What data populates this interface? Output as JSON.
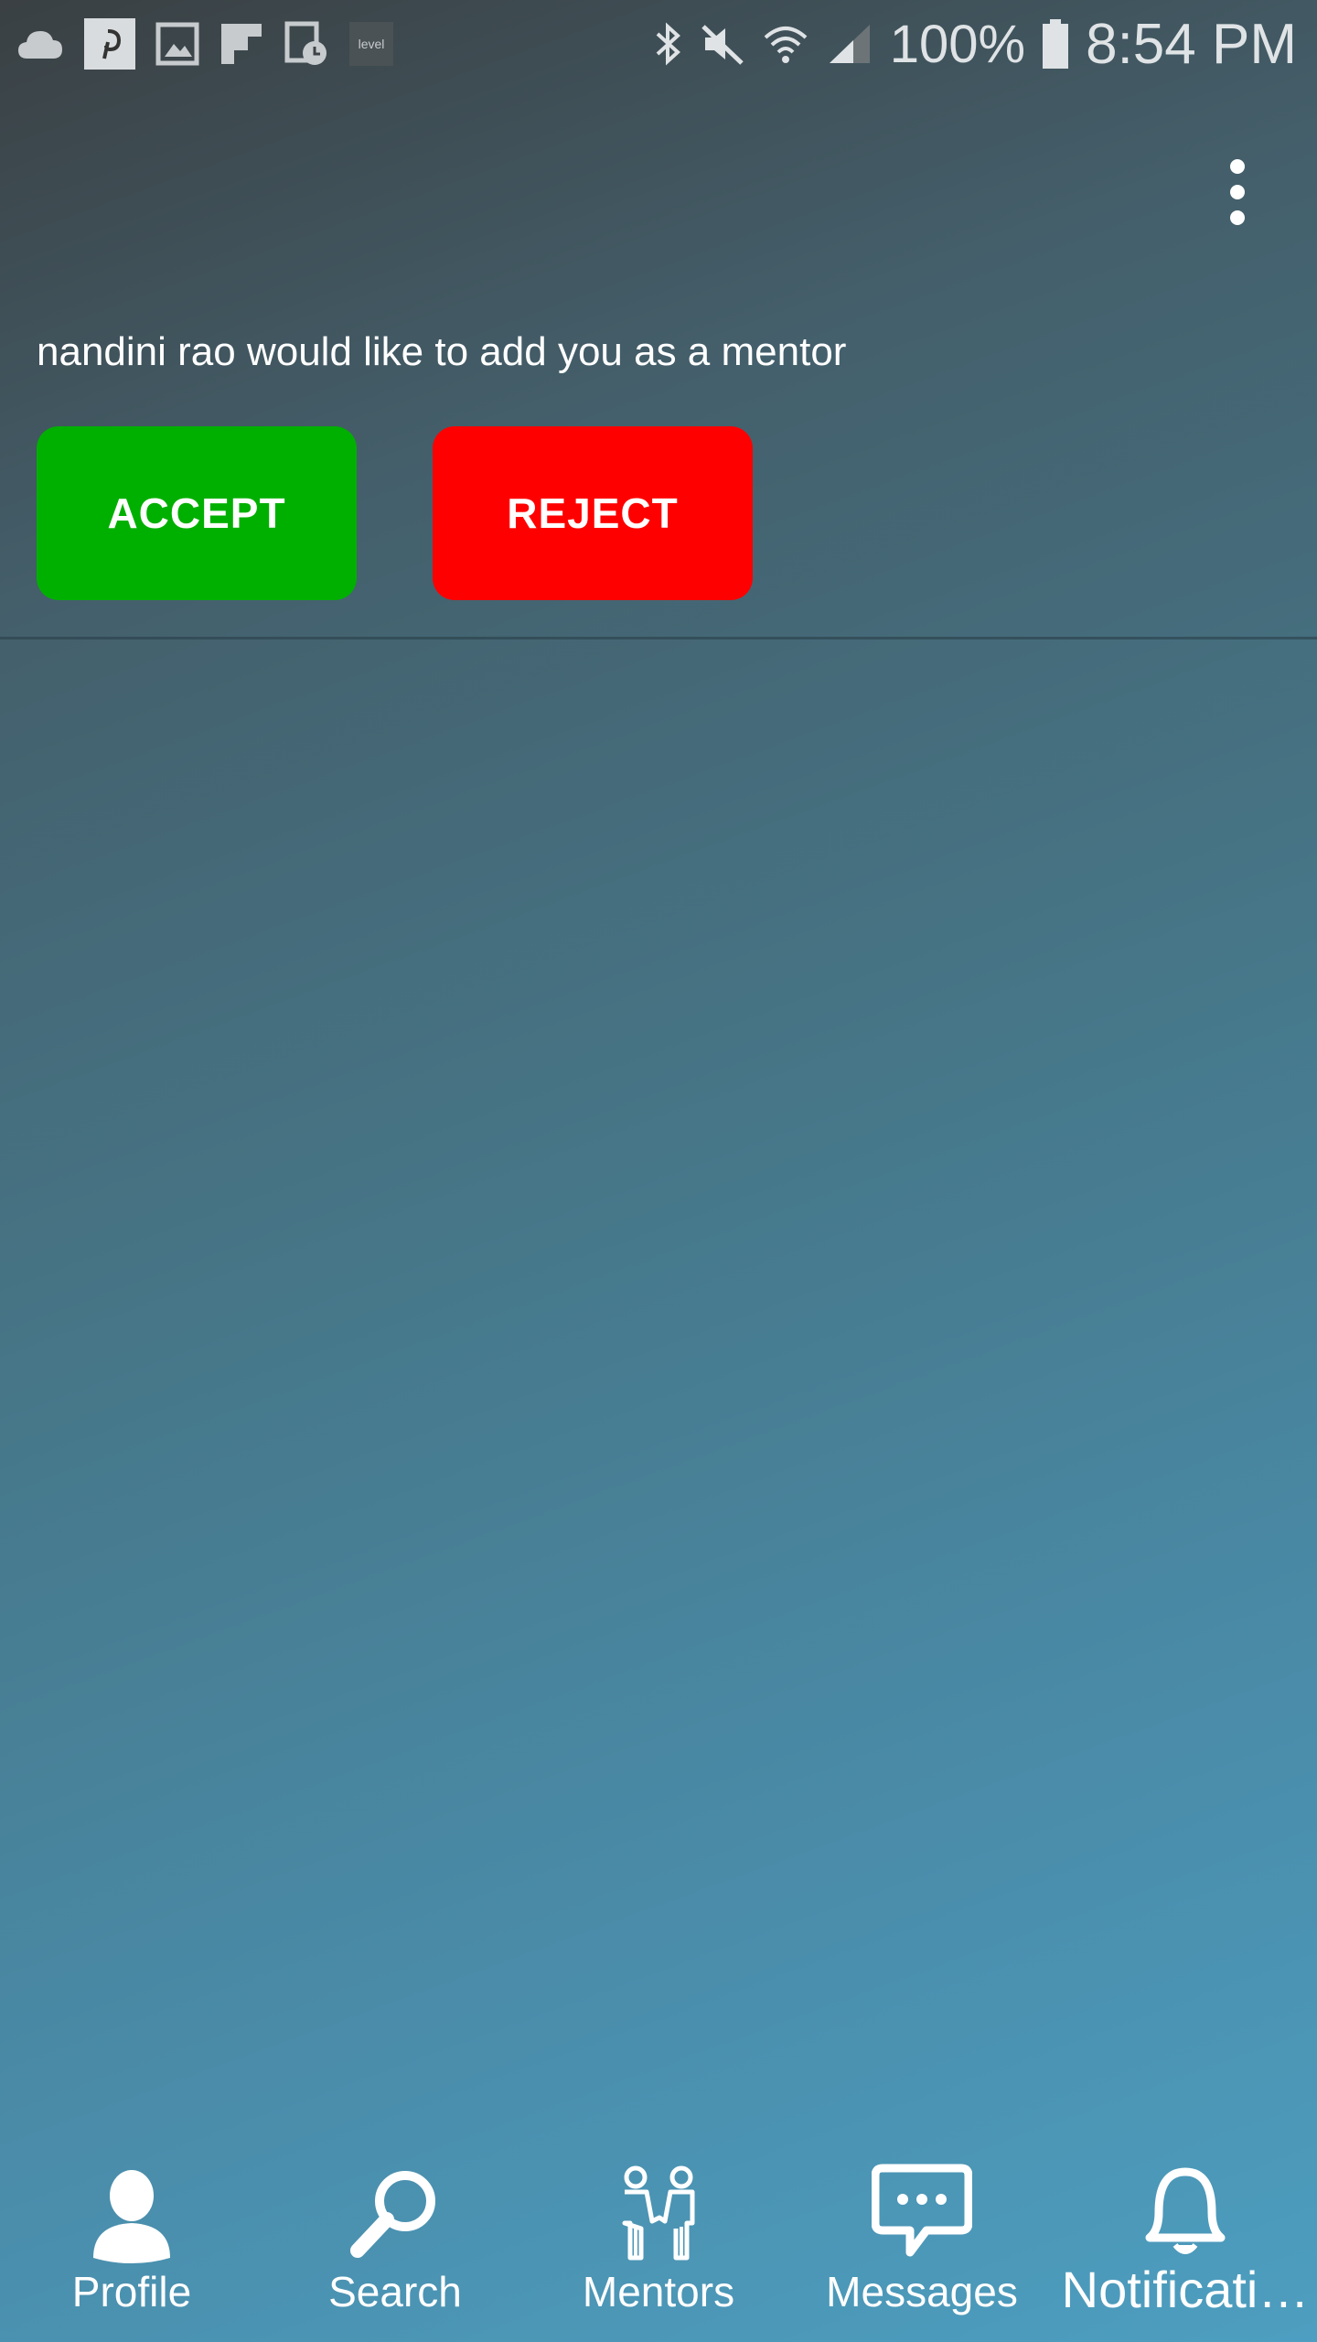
{
  "status_bar": {
    "left_icons": [
      "cloud-icon",
      "pinterest-icon",
      "gallery-icon",
      "flipboard-icon",
      "calendar-clock-icon",
      "level-icon"
    ],
    "level_label": "level",
    "battery_percent": "100%",
    "time": "8:54 PM"
  },
  "request": {
    "message": "nandini rao would like to add you as a mentor",
    "accept_label": "ACCEPT",
    "reject_label": "REJECT",
    "accept_color": "#00b000",
    "reject_color": "#ff0000"
  },
  "bottom_nav": {
    "items": [
      {
        "label": "Profile",
        "icon": "person-icon"
      },
      {
        "label": "Search",
        "icon": "search-icon"
      },
      {
        "label": "Mentors",
        "icon": "mentors-icon"
      },
      {
        "label": "Messages",
        "icon": "chat-bubble-icon"
      },
      {
        "label": "Notificati…",
        "icon": "bell-icon"
      }
    ]
  }
}
